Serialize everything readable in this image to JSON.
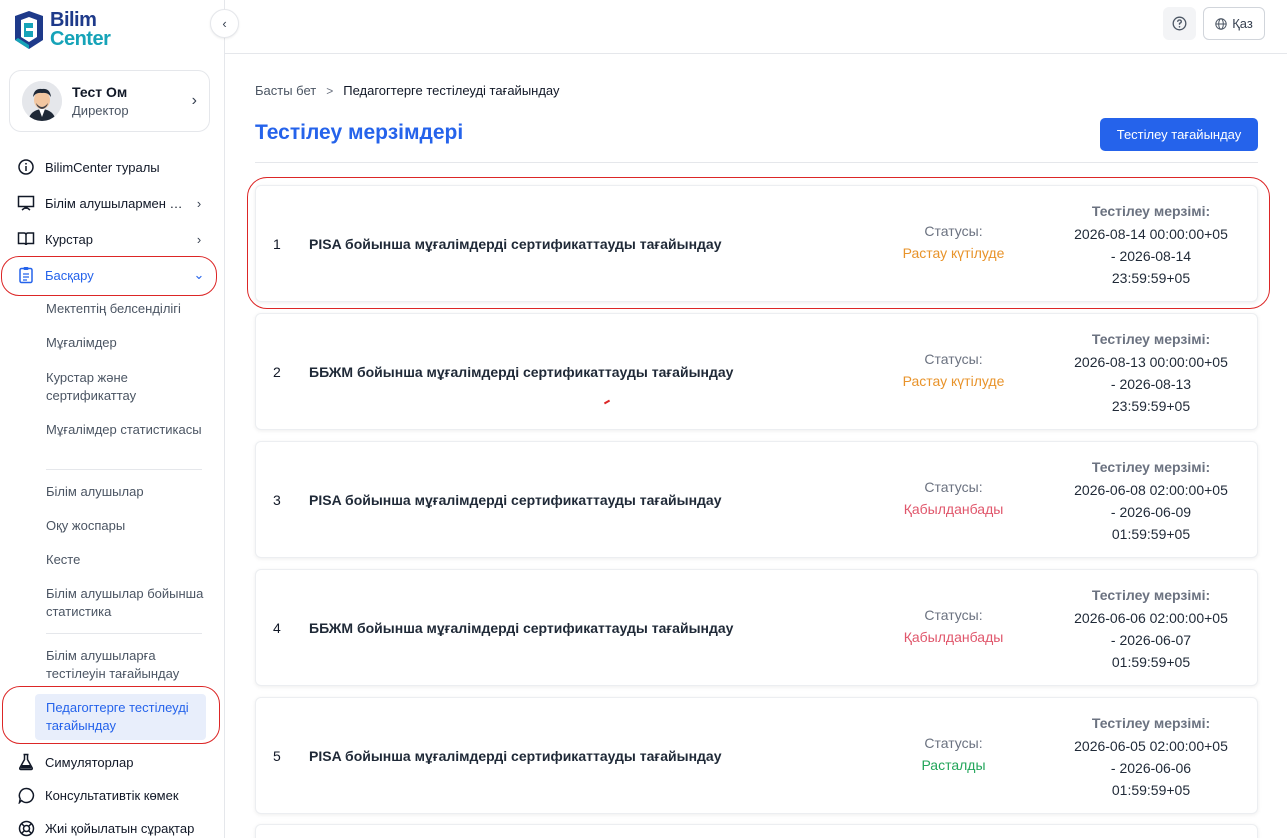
{
  "app": {
    "logo_line1": "Bilim",
    "logo_line2": "Center"
  },
  "profile": {
    "name": "Тест Ом",
    "role": "Директор"
  },
  "nav": {
    "about": "BilimCenter туралы",
    "students_menu": "Білім алушылармен жұмыс",
    "courses": "Курстар",
    "management": "Басқару",
    "simulators": "Симуляторлар",
    "consulting": "Консультативтік көмек",
    "faq": "Жиі қойылатын сұрақтар"
  },
  "submenu": {
    "school_activity": "Мектептің белсенділігі",
    "teachers": "Мұғалімдер",
    "courses_cert": "Курстар және сертификаттау",
    "teacher_stats": "Мұғалімдер статистикасы",
    "students": "Білім алушылар",
    "study_plan": "Оқу жоспары",
    "schedule": "Кесте",
    "student_stats": "Білім алушылар бойынша статистика",
    "assign_student_tests": "Білім алушыларға тестілеуін тағайындау",
    "assign_teacher_tests": "Педагогтерге тестілеуді тағайындау"
  },
  "header": {
    "lang": "Қаз"
  },
  "breadcrumb": {
    "home": "Басты бет",
    "current": "Педагогтерге тестілеуді тағайындау"
  },
  "page": {
    "title": "Тестілеу мерзімдері",
    "assign_button": "Тестілеу тағайындау",
    "status_label": "Статусы:",
    "date_label": "Тестілеу мерзімі:"
  },
  "cards": [
    {
      "num": "1",
      "title": "PISA бойынша мұғалімдерді сертификаттауды тағайындау",
      "status": "Растау күтілуде",
      "status_type": "pending",
      "date_start": "2026-08-14 00:00:00+05",
      "date_mid": "- 2026-08-14",
      "date_end": "23:59:59+05"
    },
    {
      "num": "2",
      "title": "ББЖМ бойынша мұғалімдерді сертификаттауды тағайындау",
      "status": "Растау күтілуде",
      "status_type": "pending",
      "date_start": "2026-08-13 00:00:00+05",
      "date_mid": "- 2026-08-13",
      "date_end": "23:59:59+05"
    },
    {
      "num": "3",
      "title": "PISA бойынша мұғалімдерді сертификаттауды тағайындау",
      "status": "Қабылданбады",
      "status_type": "rejected",
      "date_start": "2026-06-08 02:00:00+05",
      "date_mid": "- 2026-06-09",
      "date_end": "01:59:59+05"
    },
    {
      "num": "4",
      "title": "ББЖМ бойынша мұғалімдерді сертификаттауды тағайындау",
      "status": "Қабылданбады",
      "status_type": "rejected",
      "date_start": "2026-06-06 02:00:00+05",
      "date_mid": "- 2026-06-07",
      "date_end": "01:59:59+05"
    },
    {
      "num": "5",
      "title": "PISA бойынша мұғалімдерді сертификаттауды тағайындау",
      "status": "Расталды",
      "status_type": "approved",
      "date_start": "2026-06-05 02:00:00+05",
      "date_mid": "- 2026-06-06",
      "date_end": "01:59:59+05"
    }
  ],
  "colors": {
    "accent": "#2563eb",
    "pending": "#e8932a",
    "rejected": "#e0566b",
    "approved": "#22a55a",
    "highlight": "#dc2626"
  }
}
